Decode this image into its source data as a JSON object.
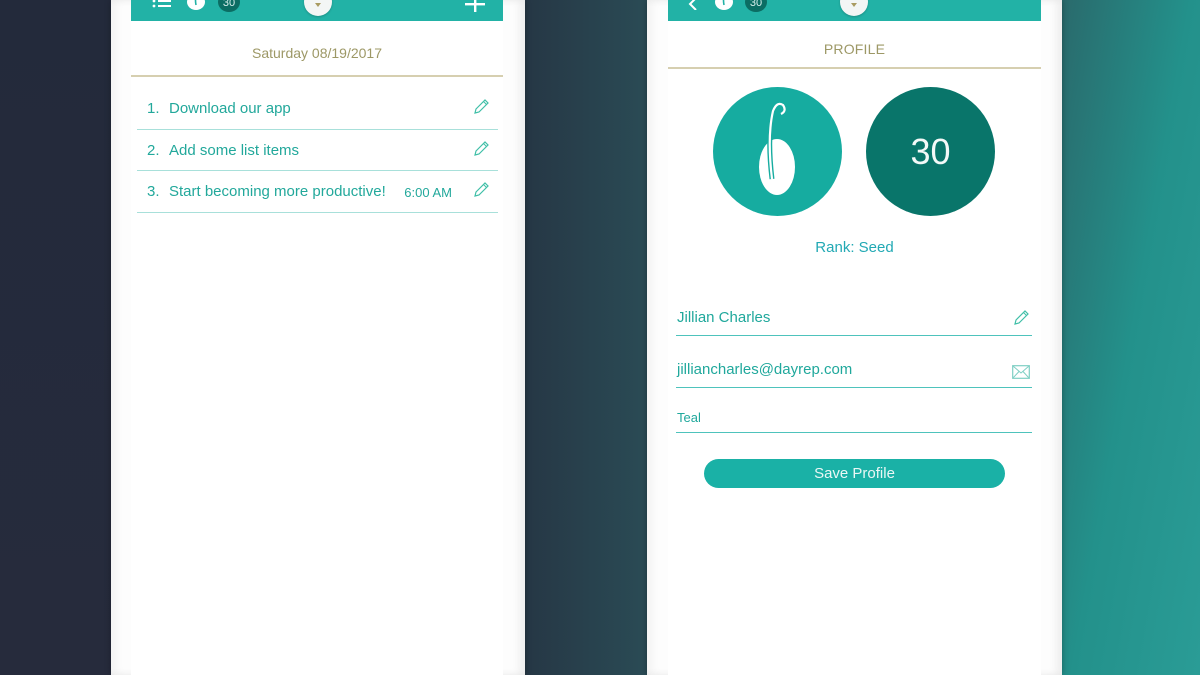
{
  "colors": {
    "accent_teal": "#22b2a6",
    "dark_teal": "#09756a",
    "gold_text": "#9d9866",
    "item_text": "#22a89b"
  },
  "left_screen": {
    "topbar": {
      "icons": [
        "list-icon",
        "seed-icon",
        "plus-icon"
      ],
      "badge": "30"
    },
    "date_title": "Saturday 08/19/2017",
    "todos": [
      {
        "num": "1.",
        "text": "Download our app",
        "time": "",
        "icon": "pencil-icon"
      },
      {
        "num": "2.",
        "text": "Add some list items",
        "time": "",
        "icon": "pencil-icon"
      },
      {
        "num": "3.",
        "text": "Start becoming more productive!",
        "time": "6:00 AM",
        "icon": "pencil-icon"
      }
    ]
  },
  "right_screen": {
    "topbar": {
      "icons": [
        "back-icon",
        "seed-icon"
      ],
      "badge": "30"
    },
    "title": "PROFILE",
    "level": "30",
    "rank": "Rank: Seed",
    "fields": {
      "name": "Jillian Charles",
      "email": "jilliancharles@dayrep.com",
      "color": "Teal"
    },
    "save_label": "Save Profile"
  }
}
